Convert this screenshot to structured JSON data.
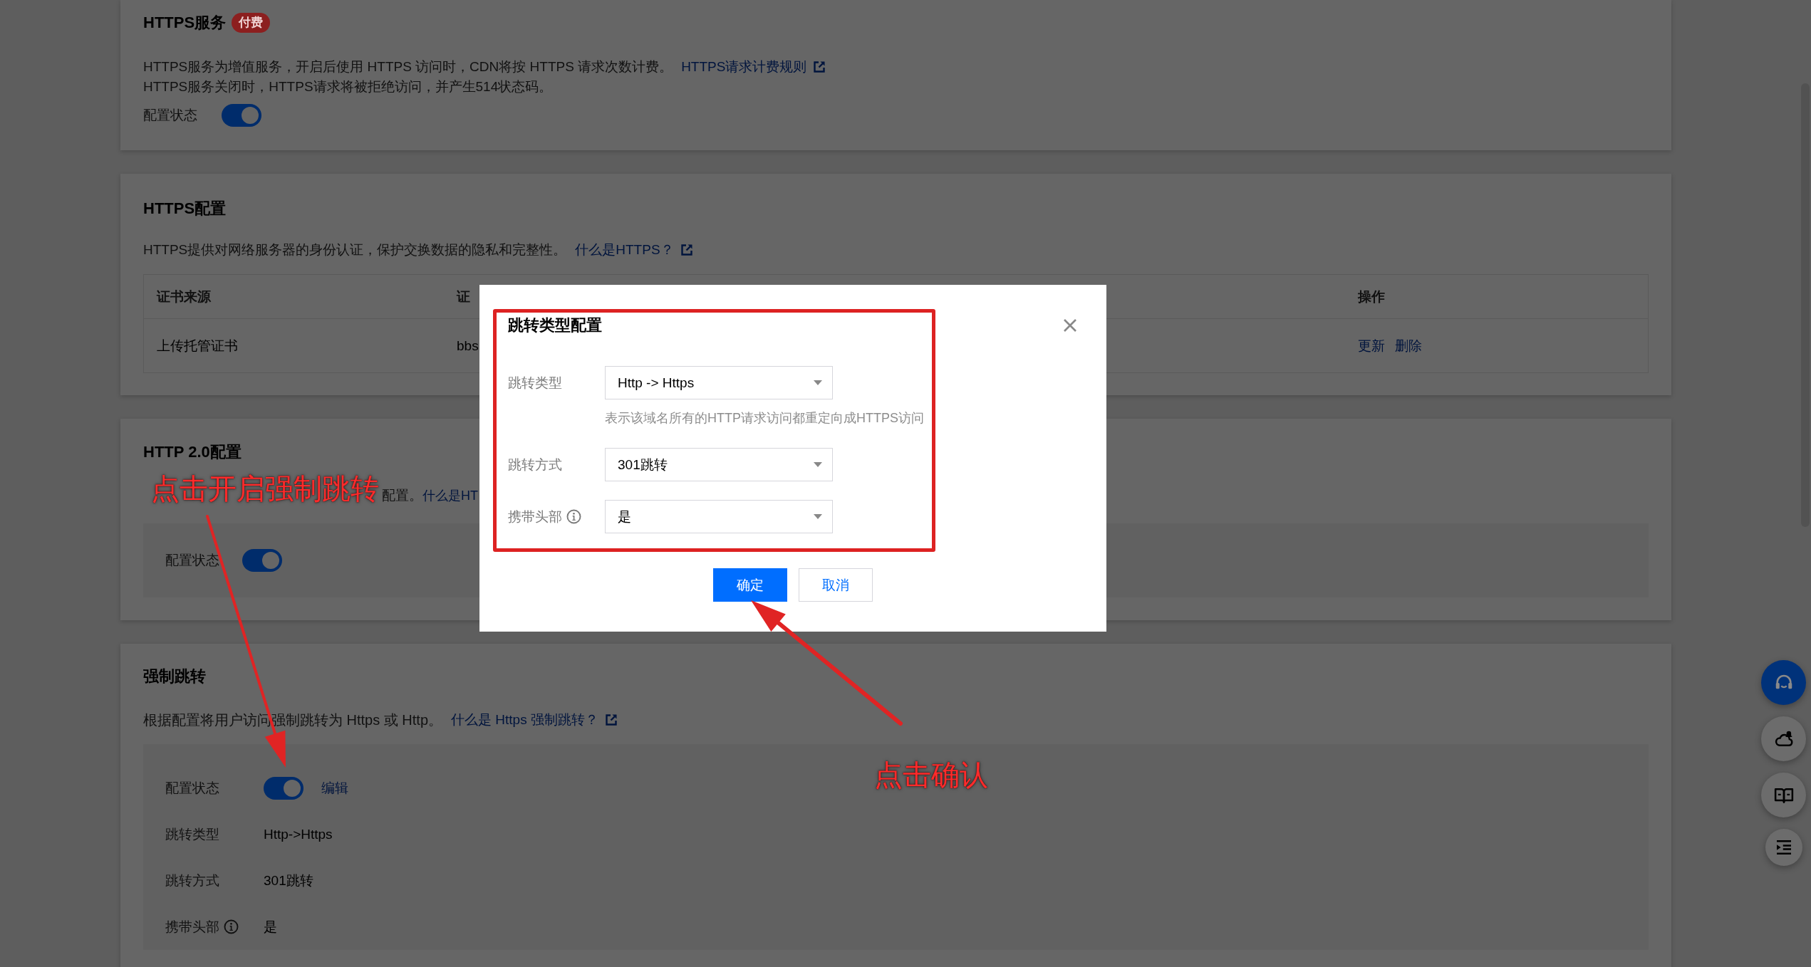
{
  "https_service": {
    "title": "HTTPS服务",
    "badge": "付费",
    "lines": [
      {
        "text": "HTTPS服务为增值服务，开启后使用 HTTPS 访问时，CDN将按 HTTPS 请求次数计费。",
        "link": "HTTPS请求计费规则"
      },
      {
        "text": "HTTPS服务关闭时，HTTPS请求将被拒绝访问，并产生514状态码。"
      }
    ],
    "status_label": "配置状态",
    "status_on": true
  },
  "https_config": {
    "title": "HTTPS配置",
    "description": "HTTPS提供对网络服务器的身份认证，保护交换数据的隐私和完整性。",
    "link": "什么是HTTPS？",
    "table": {
      "columns": [
        "证书来源",
        "证",
        "操作"
      ],
      "rows": [
        {
          "source": "上传托管证书",
          "column_2": "bbs",
          "actions": [
            "更新",
            "删除"
          ]
        }
      ]
    }
  },
  "http2_config": {
    "title": "HTTP 2.0配置",
    "description": "配置。",
    "link": "什么是HT",
    "status_label": "配置状态",
    "status_on": true
  },
  "force_redirect": {
    "title": "强制跳转",
    "description": "根据配置将用户访问强制跳转为 Https 或 Http。",
    "link": "什么是 Https 强制跳转？",
    "status_label": "配置状态",
    "status_on": true,
    "edit_link": "编辑",
    "fields": [
      {
        "label": "跳转类型",
        "value": "Http->Https",
        "info": false
      },
      {
        "label": "跳转方式",
        "value": "301跳转",
        "info": false
      },
      {
        "label": "携带头部",
        "value": "是",
        "info": true
      }
    ]
  },
  "modal": {
    "title": "跳转类型配置",
    "fields": [
      {
        "label": "跳转类型",
        "value": "Http -> Https",
        "info": false,
        "hint": "表示该域名所有的HTTP请求访问都重定向成HTTPS访问"
      },
      {
        "label": "跳转方式",
        "value": "301跳转",
        "info": false
      },
      {
        "label": "携带头部",
        "value": "是",
        "info": true
      }
    ],
    "buttons": [
      {
        "label": "确定",
        "kind": "primary"
      },
      {
        "label": "取消",
        "kind": "default"
      }
    ]
  },
  "annotations": [
    {
      "text": "点击开启强制跳转"
    },
    {
      "text": "点击确认"
    }
  ],
  "side_buttons": [
    {
      "kind": "headset",
      "selected": true
    },
    {
      "kind": "cloud",
      "selected": false
    },
    {
      "kind": "book",
      "selected": false
    },
    {
      "kind": "list",
      "selected": false
    }
  ]
}
